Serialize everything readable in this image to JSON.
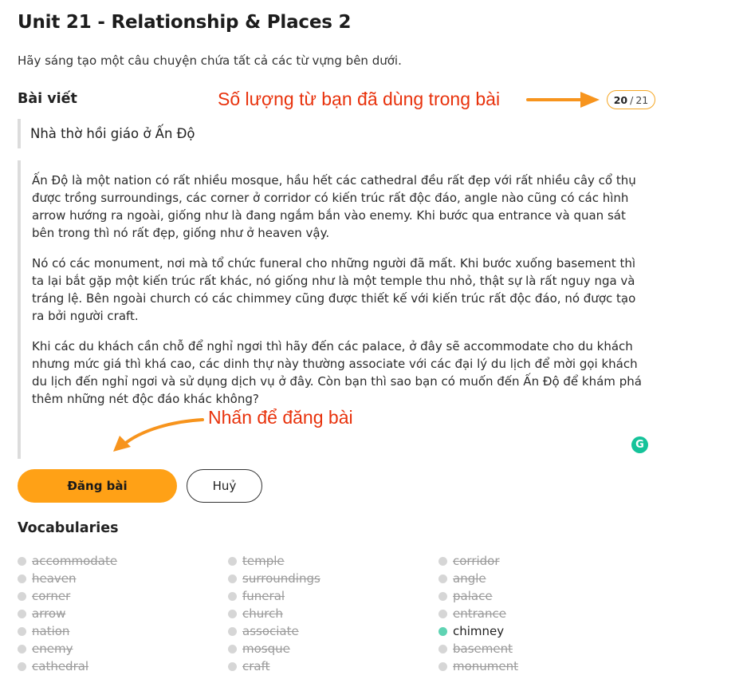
{
  "page": {
    "title": "Unit 21 - Relationship & Places 2",
    "instruction": "Hãy sáng tạo một câu chuyện chứa tất cả các từ vựng bên dưới."
  },
  "editor": {
    "section_label": "Bài viết",
    "counter": {
      "used": "20",
      "separator": "/",
      "total": "21"
    },
    "post_title": "Nhà thờ hồi giáo ở Ấn Độ",
    "paragraphs": [
      "Ấn Độ là một nation có rất nhiều mosque, hầu hết các cathedral đều rất đẹp với rất nhiều cây cổ thụ được trồng surroundings, các corner ở corridor có kiến trúc rất độc đáo, angle nào cũng có các hình arrow hướng ra ngoài, giống như là đang ngắm bắn vào enemy. Khi bước qua entrance và quan sát bên trong thì nó rất đẹp, giống như ở heaven vậy.",
      "Nó có các monument, nơi mà tổ chức funeral cho những người đã mất. Khi bước xuống basement thì ta lại bắt gặp một kiến trúc rất khác, nó giống như là một temple thu nhỏ, thật sự là rất nguy nga và tráng lệ. Bên ngoài church có các chimmey cũng được thiết kế với kiến trúc rất độc đáo, nó được tạo ra bởi người craft.",
      "Khi các du khách cần chỗ để nghỉ ngơi thì hãy đến các palace, ở đây sẽ accommodate cho du khách nhưng mức giá thì khá cao, các dinh thự này thường associate với các đại lý du lịch để mời gọi khách du lịch đến nghỉ ngơi và sử dụng dịch vụ ở đây. Còn bạn thì sao bạn có muốn đến Ấn Độ để khám phá thêm những nét độc đáo khác không?"
    ],
    "grammarly_icon": "grammarly-icon"
  },
  "annotations": {
    "word_count_note": "Số lượng từ bạn đã dùng trong bài",
    "post_note": "Nhấn để đăng bài",
    "arrow_color": "#f7941d",
    "note_color": "#e8320c"
  },
  "actions": {
    "post_label": "Đăng bài",
    "cancel_label": "Huỷ"
  },
  "colors": {
    "accent": "#ffa116",
    "used_dot": "#d6d6d6",
    "unused_dot": "#5fd3b3"
  },
  "vocabularies": {
    "heading": "Vocabularies",
    "columns": [
      [
        {
          "word": "accommodate",
          "used": true
        },
        {
          "word": "heaven",
          "used": true
        },
        {
          "word": "corner",
          "used": true
        },
        {
          "word": "arrow",
          "used": true
        },
        {
          "word": "nation",
          "used": true
        },
        {
          "word": "enemy",
          "used": true
        },
        {
          "word": "cathedral",
          "used": true
        }
      ],
      [
        {
          "word": "temple",
          "used": true
        },
        {
          "word": "surroundings",
          "used": true
        },
        {
          "word": "funeral",
          "used": true
        },
        {
          "word": "church",
          "used": true
        },
        {
          "word": "associate",
          "used": true
        },
        {
          "word": "mosque",
          "used": true
        },
        {
          "word": "craft",
          "used": true
        }
      ],
      [
        {
          "word": "corridor",
          "used": true
        },
        {
          "word": "angle",
          "used": true
        },
        {
          "word": "palace",
          "used": true
        },
        {
          "word": "entrance",
          "used": true
        },
        {
          "word": "chimney",
          "used": false
        },
        {
          "word": "basement",
          "used": true
        },
        {
          "word": "monument",
          "used": true
        }
      ]
    ]
  }
}
